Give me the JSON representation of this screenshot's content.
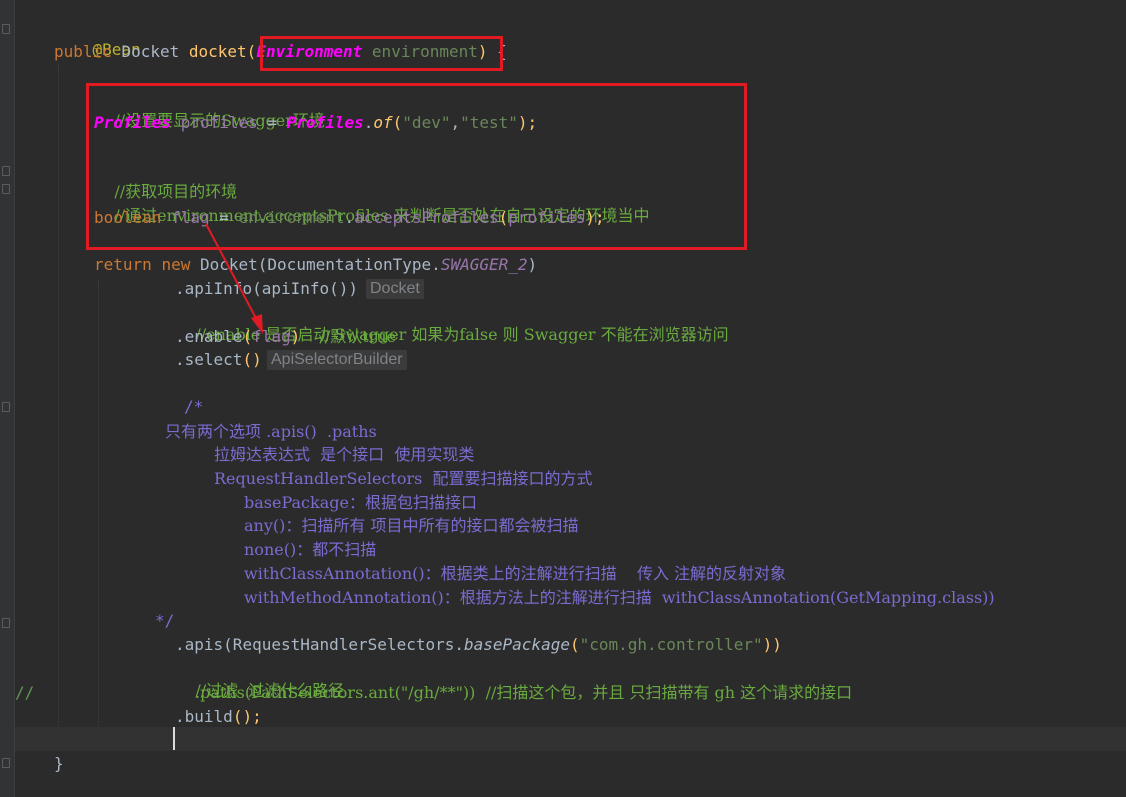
{
  "code": {
    "l_annotation": "@Bean",
    "l_sig_public": "public",
    "l_sig_docket": "Docket",
    "l_sig_method": "docket",
    "l_sig_open": "(",
    "l_sig_type": "Environment",
    "l_sig_param": "environment",
    "l_sig_close": ")",
    "l_sig_brace": "{",
    "c1": "//设置要显示的Swagger环境",
    "p_type": "Profiles",
    "p_var": "profiles",
    "p_eq": "=",
    "p_cls": "Profiles",
    "p_dot": ".",
    "p_of": "of",
    "p_open": "(",
    "p_s1": "\"dev\"",
    "p_comma": ",",
    "p_s2": "\"test\"",
    "p_close": ");",
    "c2": "//获取项目的环境",
    "c3": "//通过environment.acceptsProfiles 来判断是否处在自己设定的环境当中",
    "b_kw": "boolean",
    "b_var": "flag",
    "b_eq": "=",
    "b_env": "environment",
    "b_dot": ".",
    "b_method": "acceptsProfiles",
    "b_open": "(",
    "b_arg": "profiles",
    "b_close": ");",
    "r_return": "return",
    "r_new": "new",
    "r_docket": "Docket",
    "r_open": "(DocumentationType.",
    "r_const": "SWAGGER_2",
    "r_close": ")",
    "a_dot": ".",
    "a_method": "apiInfo",
    "a_args": "(apiInfo())",
    "a_hint": "Docket",
    "en_comment": "//enable 是否启动 Swagger 如果为false 则 Swagger 不能在浏览器访问",
    "en_dot": ".",
    "en_method": "enable",
    "en_open": "(",
    "en_arg": "flag",
    "en_close": ")",
    "en_trail": "//默认true",
    "sel_dot": ".",
    "sel_method": "select",
    "sel_args": "()",
    "sel_hint": "ApiSelectorBuilder",
    "bc_open": "/*",
    "bc1": "只有两个选项 .apis()  .paths",
    "bc2": "拉姆达表达式  是个接口  使用实现类",
    "bc3": "RequestHandlerSelectors  配置要扫描接口的方式",
    "bc4": "basePackage：根据包扫描接口",
    "bc5": "any()：扫描所有 项目中所有的接口都会被扫描",
    "bc6": "none()：都不扫描",
    "bc7": "withClassAnnotation()：根据类上的注解进行扫描    传入 注解的反射对象",
    "bc8": "withMethodAnnotation()：根据方法上的注解进行扫描  withClassAnnotation(GetMapping.class))",
    "bc_close": "*/",
    "ap_dot": ".",
    "ap_method": "apis",
    "ap_open": "(RequestHandlerSelectors.",
    "ap_static": "basePackage",
    "ap_paren": "(",
    "ap_str": "\"com.gh.controller\"",
    "ap_close": "))",
    "filter_comment": "//过滤  过滤什么路径",
    "pa_prefix": "//",
    "pa_code": ".paths(PathSelectors.ant(\"/gh/**\"))  //扫描这个包，并且 只扫描带有 gh 这个请求的接口",
    "bu_dot": ".",
    "bu_method": "build",
    "bu_close": "();",
    "end_brace": "}"
  },
  "colors": {
    "background": "#2b2b2b",
    "keyword": "#cc7832",
    "string": "#6a8759",
    "annotation": "#bbb529",
    "method": "#ffc66d",
    "comment": "#629755",
    "block_comment": "#7a6cd1",
    "highlight_box": "#e01b24",
    "type_highlight": "#ff00ff"
  }
}
